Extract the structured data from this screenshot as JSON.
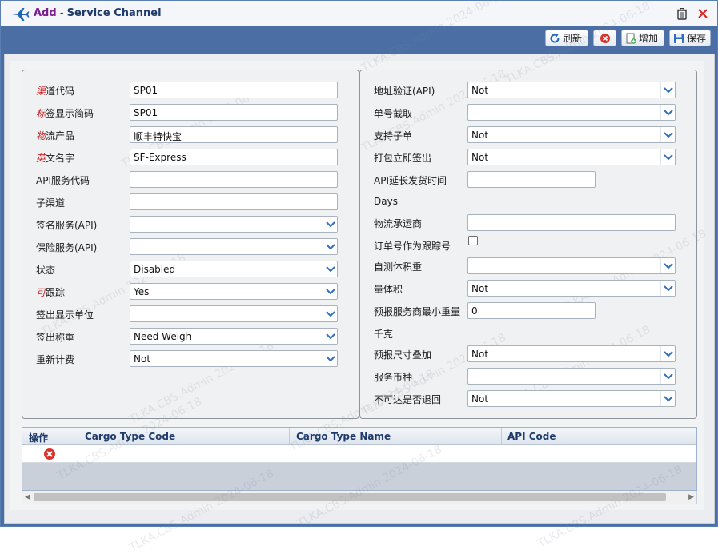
{
  "title": {
    "accent": "Add",
    "sep": " - ",
    "main": "Service Channel"
  },
  "toolbar": {
    "refresh": "刷新",
    "add": "增加",
    "save": "保存"
  },
  "left_fields": [
    {
      "req": "渠",
      "label": "道代码",
      "value": "SP01",
      "type": "input"
    },
    {
      "req": "标",
      "label": "签显示简码",
      "value": "SP01",
      "type": "input"
    },
    {
      "req": "物",
      "label": "流产品",
      "value": "顺丰特快宝",
      "type": "input"
    },
    {
      "req": "英",
      "label": "文名字",
      "value": "SF-Express",
      "type": "input"
    },
    {
      "req": "",
      "label": "API服务代码",
      "value": "",
      "type": "input"
    },
    {
      "req": "",
      "label": "子渠道",
      "value": "",
      "type": "input"
    },
    {
      "req": "",
      "label": "签名服务(API)",
      "value": "",
      "type": "select"
    },
    {
      "req": "",
      "label": "保险服务(API)",
      "value": "",
      "type": "select"
    },
    {
      "req": "",
      "label": "状态",
      "value": "Disabled",
      "type": "select"
    },
    {
      "req": "可",
      "label": "跟踪",
      "value": "Yes",
      "type": "select"
    },
    {
      "req": "",
      "label": "签出显示单位",
      "value": "",
      "type": "select"
    },
    {
      "req": "",
      "label": "签出称重",
      "value": "Need Weigh",
      "type": "select"
    },
    {
      "req": "",
      "label": "重新计费",
      "value": "Not",
      "type": "select"
    }
  ],
  "right_fields": [
    {
      "label": "地址验证(API)",
      "value": "Not",
      "type": "select"
    },
    {
      "label": "单号截取",
      "value": "",
      "type": "select"
    },
    {
      "label": "支持子单",
      "value": "Not",
      "type": "select"
    },
    {
      "label": "打包立即签出",
      "value": "Not",
      "type": "select"
    },
    {
      "label": "API延长发货时间",
      "value": "",
      "type": "input-short",
      "unit": "Days"
    },
    {
      "label": "物流承运商",
      "value": "",
      "type": "input"
    },
    {
      "label": "订单号作为跟踪号",
      "value": "",
      "type": "checkbox"
    },
    {
      "label": "自测体积重",
      "value": "",
      "type": "select"
    },
    {
      "label": "量体积",
      "value": "Not",
      "type": "select"
    },
    {
      "label": "预报服务商最小重量",
      "value": "0",
      "type": "input-short",
      "unit": "千克"
    },
    {
      "label": "预报尺寸叠加",
      "value": "Not",
      "type": "select"
    },
    {
      "label": "服务币种",
      "value": "",
      "type": "select"
    },
    {
      "label": "不可达是否退回",
      "value": "Not",
      "type": "select"
    }
  ],
  "grid": {
    "columns": [
      "操作",
      "Cargo Type Code",
      "Cargo Type Name",
      "API Code"
    ]
  },
  "watermark": "TLKA.CBS.Admin 2024-06-18",
  "colors": {
    "titlebar_accent": "#7a1f8f",
    "header_blue": "#4b6fa5",
    "required_red": "#cc2222"
  },
  "icons": [
    "airplane-icon",
    "trash-icon",
    "close-icon",
    "refresh-icon",
    "cancel-icon",
    "add-icon",
    "save-icon",
    "delete-row-icon",
    "chevron-down-icon"
  ]
}
